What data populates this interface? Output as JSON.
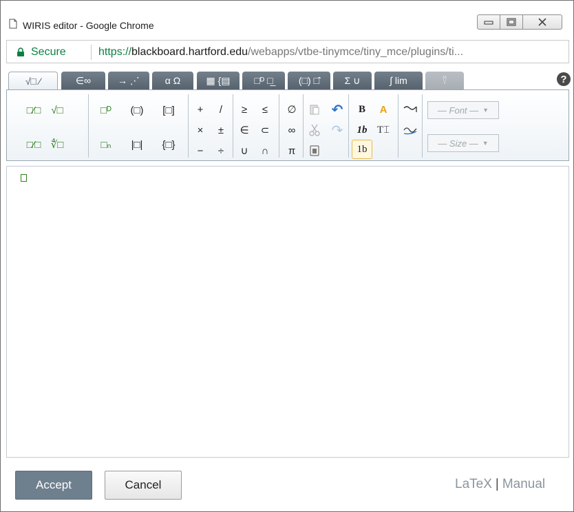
{
  "window": {
    "title": "WIRIS editor - Google Chrome",
    "minimize_icon": "minimize-icon",
    "maximize_icon": "maximize-icon",
    "close_icon": "close-icon"
  },
  "address_bar": {
    "secure_label": "Secure",
    "url_scheme": "https://",
    "url_host": "blackboard.hartford.edu",
    "url_path": "/webapps/vtbe-tinymce/tiny_mce/plugins/ti..."
  },
  "tabs": [
    {
      "id": "general",
      "label": "√□ ⁄",
      "active": true
    },
    {
      "id": "symbols",
      "label": "∈∞",
      "active": false
    },
    {
      "id": "arrows",
      "label": "→ ⋰",
      "active": false
    },
    {
      "id": "greek",
      "label": "α Ω",
      "active": false
    },
    {
      "id": "matrices",
      "label": "▦ {▤",
      "active": false
    },
    {
      "id": "scripts",
      "label": "□ᴰ □̲",
      "active": false
    },
    {
      "id": "decorations",
      "label": "(□) □̂",
      "active": false
    },
    {
      "id": "bigops",
      "label": "Σ ∪",
      "active": false
    },
    {
      "id": "calculus",
      "label": "∫ lim",
      "active": false
    },
    {
      "id": "contributed",
      "label": "⍢",
      "active": false,
      "disabled": true
    }
  ],
  "toolbar": {
    "fraction": "□⁄□",
    "sqrt": "√□",
    "superscript": "□ᴰ",
    "parentheses": "(□)",
    "brackets": "[□]",
    "bevelled_fraction": "□⁄□",
    "nth_root": "∜□",
    "subscript": "□ₙ",
    "absolute": "|□|",
    "braces": "{□}",
    "plus": "+",
    "slash": "/",
    "times": "×",
    "plusminus": "±",
    "minus": "−",
    "divide": "÷",
    "geq": "≥",
    "leq": "≤",
    "in": "∈",
    "subset": "⊂",
    "union": "∪",
    "intersection": "∩",
    "emptyset": "∅",
    "infinity": "∞",
    "pi": "π",
    "paste": "paste-icon",
    "undo": "↶",
    "cut": "cut-icon",
    "redo": "↷",
    "clipboard": "clipboard-icon",
    "bold": "B",
    "color": "A",
    "italic_1b": "1b",
    "text_mode": "T⌶",
    "number_1b": "1b",
    "rtl": "rtl-icon",
    "ltr": "ltr-icon",
    "font_dropdown": "— Font —",
    "size_dropdown": "— Size —"
  },
  "footer": {
    "accept_label": "Accept",
    "cancel_label": "Cancel",
    "latex_link": "LaTeX",
    "separator": "|",
    "manual_link": "Manual"
  },
  "colors": {
    "tab_bg": "#5e6b77",
    "accent_green": "#2e7d1e",
    "secure_green": "#0b8043",
    "accept_bg": "#6e7f8e"
  }
}
